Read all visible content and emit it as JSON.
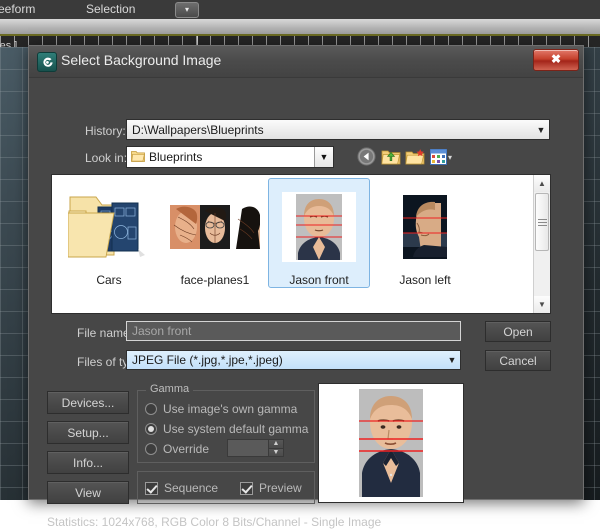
{
  "background": {
    "menu_items": [
      "reeform",
      "Selection"
    ],
    "menu_button_glyph": "▾",
    "left_label": "aces ]"
  },
  "dialog": {
    "title": "Select Background Image",
    "app_icon": "spiral-logo-icon",
    "close_label": "✖",
    "history": {
      "label": "History:",
      "value": "D:\\Wallpapers\\Blueprints",
      "arrow": "▼"
    },
    "look_in": {
      "label": "Look in:",
      "value": "Blueprints",
      "arrow": "▼"
    },
    "toolbar": {
      "back": "back-icon",
      "up_one_level": "up-one-level-icon",
      "new_folder": "new-folder-icon",
      "views": "views-icon",
      "views_caret": "▾"
    },
    "files": [
      {
        "name": "Cars",
        "kind": "folder",
        "selected": false
      },
      {
        "name": "face-planes1",
        "kind": "image",
        "selected": false
      },
      {
        "name": "Jason front",
        "kind": "image",
        "selected": true
      },
      {
        "name": "Jason left",
        "kind": "image",
        "selected": false
      }
    ],
    "scrollbar": {
      "up": "▲",
      "down": "▼"
    },
    "file_name": {
      "label": "File name:",
      "value": "Jason front"
    },
    "files_of_type": {
      "label": "Files of type:",
      "value": "JPEG File (*.jpg,*.jpe,*.jpeg)",
      "arrow": "▼"
    },
    "buttons": {
      "open": "Open",
      "cancel": "Cancel",
      "devices": "Devices...",
      "setup": "Setup...",
      "info": "Info...",
      "view": "View"
    },
    "gamma": {
      "title": "Gamma",
      "options": [
        {
          "label": "Use image's own gamma",
          "selected": false
        },
        {
          "label": "Use system default gamma",
          "selected": true
        },
        {
          "label": "Override",
          "selected": false
        }
      ],
      "override_value": "",
      "spin_up": "▲",
      "spin_down": "▼"
    },
    "options": [
      {
        "label": "Sequence",
        "checked": true
      },
      {
        "label": "Preview",
        "checked": true
      }
    ],
    "statistics": "Statistics:  1024x768, RGB Color 8 Bits/Channel - Single Image"
  },
  "colors": {
    "dialog_bg": "#474747",
    "selection_blue": "#ddeefc",
    "selection_border": "#7eb4e2",
    "combo_highlight": "#cfe6fb",
    "close_red": "#c5402c"
  }
}
